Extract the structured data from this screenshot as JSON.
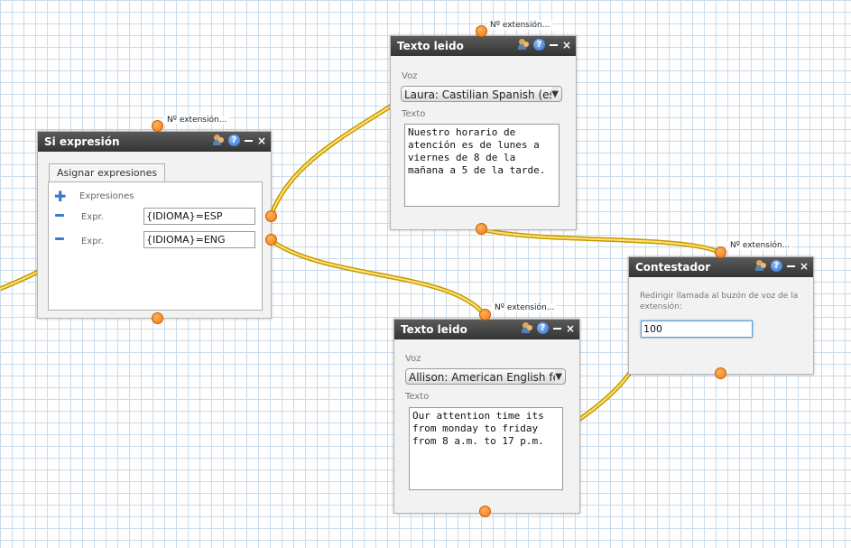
{
  "port_label": "Nº extensión...",
  "wire_colors": {
    "outer": "#c59a00",
    "inner": "#ffe27a"
  },
  "port_color": "#f07c10",
  "si_expresion": {
    "title": "Si expresión",
    "tab": "Asignar expresiones",
    "header": "Expresiones",
    "rows": [
      {
        "label": "Expr.",
        "value": "{IDIOMA}=ESP"
      },
      {
        "label": "Expr.",
        "value": "{IDIOMA}=ENG"
      }
    ]
  },
  "texto_leido_1": {
    "title": "Texto leido",
    "voz_label": "Voz",
    "voz_value": "Laura: Castilian Spanish (es",
    "texto_label": "Texto",
    "texto_value": "Nuestro horario de\natención es de lunes a\nviernes de 8 de la\nmañana a 5 de la tarde."
  },
  "texto_leido_2": {
    "title": "Texto leido",
    "voz_label": "Voz",
    "voz_value": "Allison: American English fe",
    "texto_label": "Texto",
    "texto_value": "Our attention time its\nfrom monday to friday\nfrom 8 a.m. to 17 p.m."
  },
  "contestador": {
    "title": "Contestador",
    "description": "Redirigir llamada al buzón de voz de la extensión:",
    "extension_value": "100"
  },
  "icons": [
    "users-icon",
    "help-icon",
    "minimize-icon",
    "close-icon",
    "plus-icon",
    "minus-icon",
    "dropdown-arrow-icon"
  ]
}
